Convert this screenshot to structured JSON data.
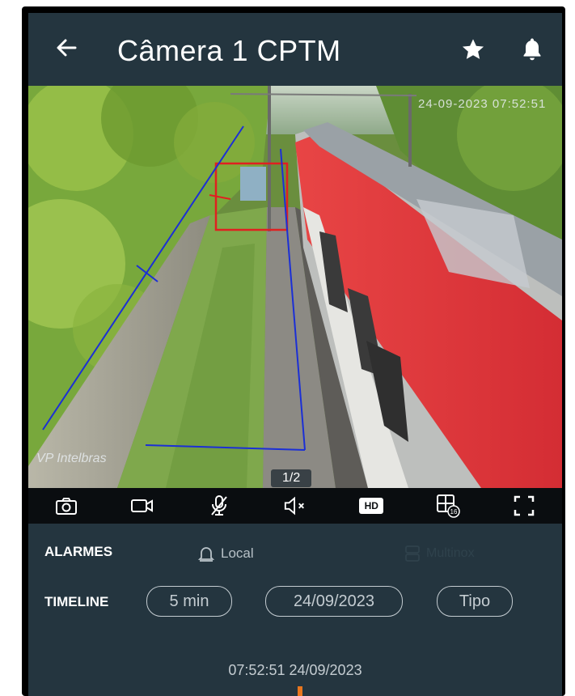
{
  "header": {
    "title": "Câmera 1 CPTM",
    "back_icon": "arrow-left-icon",
    "favorite_icon": "star-icon",
    "notification_icon": "bell-icon"
  },
  "video": {
    "overlay_timestamp": "24-09-2023 07:52:51",
    "watermark": "VP Intelbras",
    "page_indicator": "1/2"
  },
  "controls": {
    "items": [
      {
        "icon": "camera-snapshot-icon"
      },
      {
        "icon": "video-record-icon"
      },
      {
        "icon": "mic-off-icon"
      },
      {
        "icon": "speaker-mute-icon"
      },
      {
        "icon": "hd-quality-icon",
        "label": "HD"
      },
      {
        "icon": "grid-16-icon",
        "label": "16"
      },
      {
        "icon": "fullscreen-icon"
      }
    ]
  },
  "alarms": {
    "label": "ALARMES",
    "local_label": "Local",
    "multinox_label": "Multinox"
  },
  "timeline": {
    "label": "TIMELINE",
    "interval": "5 min",
    "date": "24/09/2023",
    "type": "Tipo"
  },
  "footer": {
    "time": "07:52:51",
    "date": "24/09/2023"
  },
  "colors": {
    "background": "#24353f",
    "control_bar": "#0a0d10",
    "timeline_marker": "#e8761e",
    "detection_box": "#e02020",
    "detection_line": "#1b2fd6"
  }
}
